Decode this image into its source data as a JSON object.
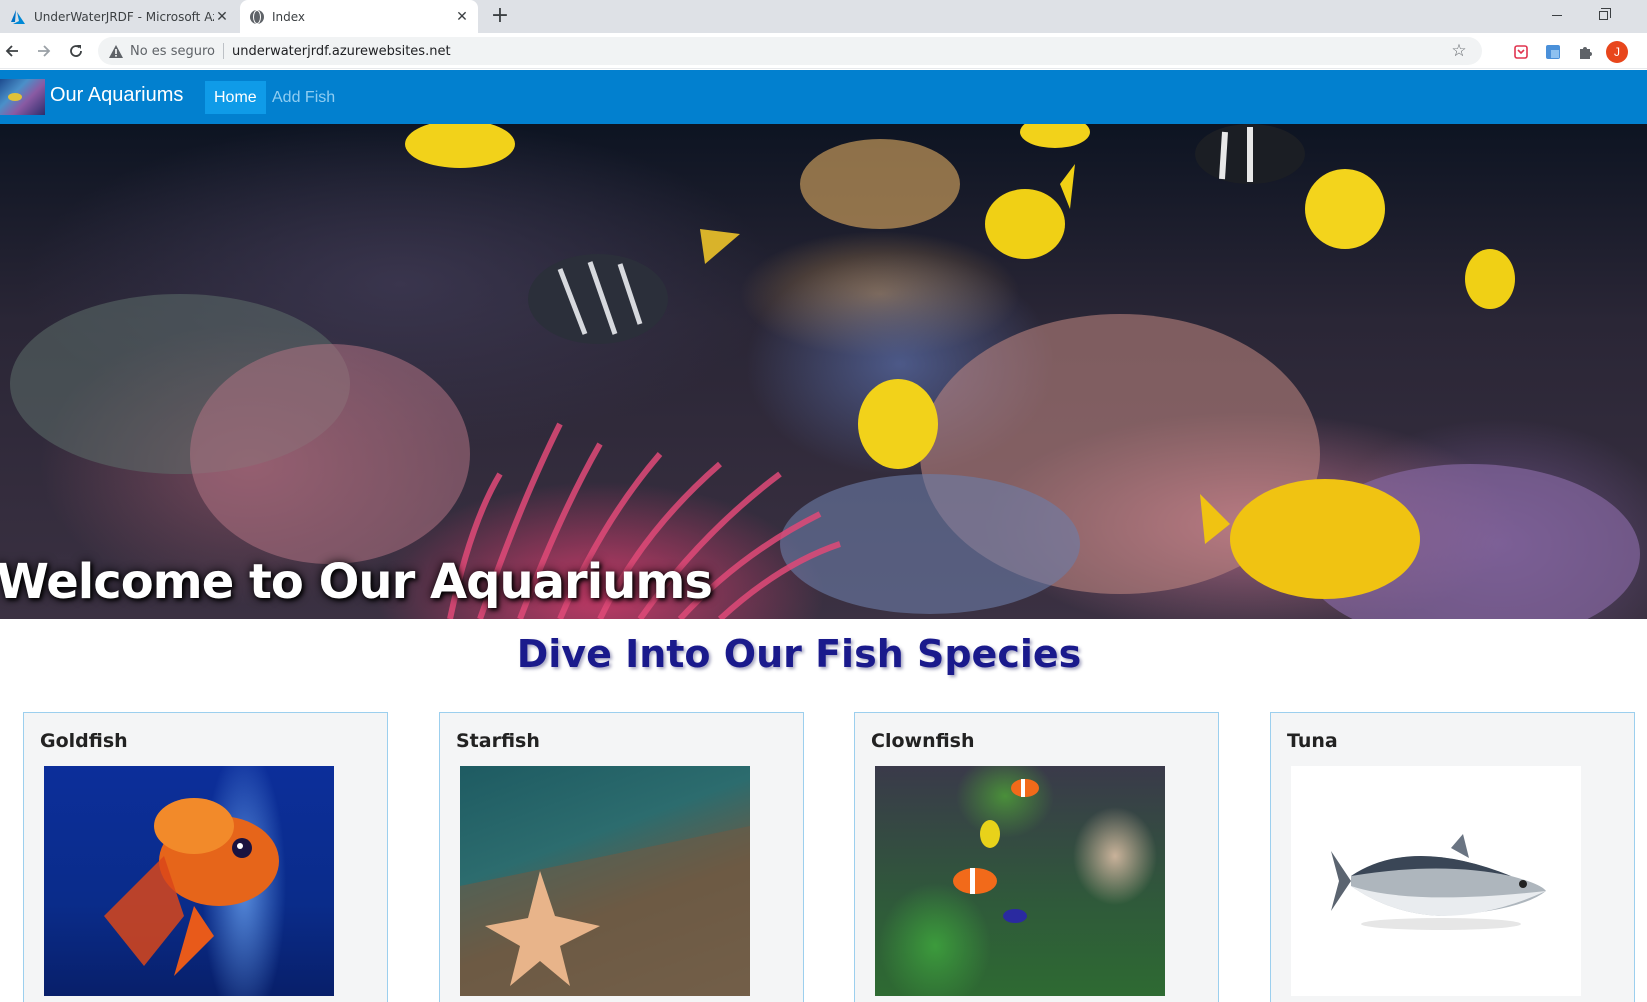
{
  "browser": {
    "tabs": [
      {
        "title": "UnderWaterJRDF - Microsoft Azure",
        "active": false,
        "icon": "azure-icon"
      },
      {
        "title": "Index",
        "active": true,
        "icon": "globe-icon"
      }
    ],
    "security_label": "No es seguro",
    "url": "underwaterjrdf.azurewebsites.net",
    "profile_initial": "J"
  },
  "site": {
    "brand": "Our Aquariums",
    "nav": [
      {
        "label": "Home",
        "active": true
      },
      {
        "label": "Add Fish",
        "active": false
      }
    ],
    "nav_color": "#0280cf"
  },
  "hero": {
    "title": "Welcome to Our Aquariums"
  },
  "section": {
    "title": "Dive Into Our Fish Species",
    "cards": [
      {
        "title": "Goldfish",
        "image": "goldfish-image"
      },
      {
        "title": "Starfish",
        "image": "starfish-image"
      },
      {
        "title": "Clownfish",
        "image": "clownfish-image"
      },
      {
        "title": "Tuna",
        "image": "tuna-image"
      }
    ]
  }
}
